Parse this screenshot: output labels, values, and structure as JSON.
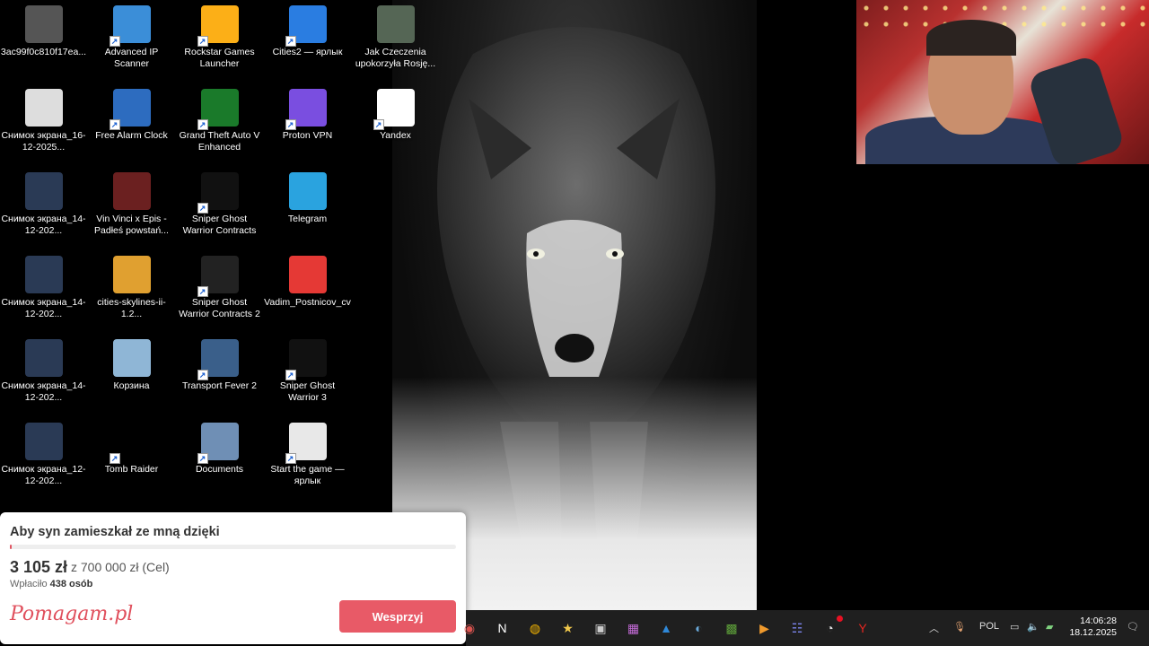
{
  "desktop": {
    "icons": [
      {
        "label": "3ac99f0c810f17ea...",
        "icon": "image-file-icon",
        "col": 0,
        "row": 0,
        "shortcut": false,
        "color": "#555555"
      },
      {
        "label": "Снимок экрана_16-12-2025...",
        "icon": "screenshot-file-icon",
        "col": 0,
        "row": 1,
        "shortcut": false,
        "color": "#dddddd"
      },
      {
        "label": "Снимок экрана_14-12-202...",
        "icon": "screenshot-file-icon",
        "col": 0,
        "row": 2,
        "shortcut": false,
        "color": "#2a3a55"
      },
      {
        "label": "Снимок экрана_14-12-202...",
        "icon": "screenshot-file-icon",
        "col": 0,
        "row": 3,
        "shortcut": false,
        "color": "#2a3a55"
      },
      {
        "label": "Снимок экрана_14-12-202...",
        "icon": "screenshot-file-icon",
        "col": 0,
        "row": 4,
        "shortcut": false,
        "color": "#2a3a55"
      },
      {
        "label": "Снимок экрана_12-12-202...",
        "icon": "screenshot-file-icon",
        "col": 0,
        "row": 5,
        "shortcut": false,
        "color": "#2a3a55"
      },
      {
        "label": "Advanced IP Scanner",
        "icon": "network-scanner-icon",
        "col": 1,
        "row": 0,
        "shortcut": true,
        "color": "#3b8ed8"
      },
      {
        "label": "Free Alarm Clock",
        "icon": "alarm-clock-icon",
        "col": 1,
        "row": 1,
        "shortcut": true,
        "color": "#2d6cbf"
      },
      {
        "label": "Vin Vinci x Epis - Padłeś powstań...",
        "icon": "video-file-icon",
        "col": 1,
        "row": 2,
        "shortcut": false,
        "color": "#6b2020"
      },
      {
        "label": "cities-skylines-ii-1.2...",
        "icon": "rocket-icon",
        "col": 1,
        "row": 3,
        "shortcut": false,
        "color": "#e0a030"
      },
      {
        "label": "Корзина",
        "icon": "recycle-bin-icon",
        "col": 1,
        "row": 4,
        "shortcut": false,
        "color": "#8fb6d6"
      },
      {
        "label": "Tomb Raider",
        "icon": "tomb-raider-icon",
        "col": 1,
        "row": 5,
        "shortcut": true,
        "color": "#000000"
      },
      {
        "label": "Rockstar Games Launcher",
        "icon": "rockstar-icon",
        "col": 2,
        "row": 0,
        "shortcut": true,
        "color": "#fcaf17"
      },
      {
        "label": "Grand Theft Auto V Enhanced",
        "icon": "gta-v-icon",
        "col": 2,
        "row": 1,
        "shortcut": true,
        "color": "#1a7a2a"
      },
      {
        "label": "Sniper Ghost Warrior Contracts",
        "icon": "sgw-contracts-icon",
        "col": 2,
        "row": 2,
        "shortcut": true,
        "color": "#111111"
      },
      {
        "label": "Sniper Ghost Warrior Contracts 2",
        "icon": "sgw-contracts-2-icon",
        "col": 2,
        "row": 3,
        "shortcut": true,
        "color": "#222222"
      },
      {
        "label": "Transport Fever 2",
        "icon": "transport-fever-icon",
        "col": 2,
        "row": 4,
        "shortcut": true,
        "color": "#3a5f8a"
      },
      {
        "label": "Documents",
        "icon": "documents-folder-icon",
        "col": 2,
        "row": 5,
        "shortcut": true,
        "color": "#6f8fb5"
      },
      {
        "label": "Cities2 — ярлык",
        "icon": "cities2-icon",
        "col": 3,
        "row": 0,
        "shortcut": true,
        "color": "#2a7de1"
      },
      {
        "label": "Proton VPN",
        "icon": "proton-vpn-icon",
        "col": 3,
        "row": 1,
        "shortcut": true,
        "color": "#7a4ee0"
      },
      {
        "label": "Telegram",
        "icon": "telegram-icon",
        "col": 3,
        "row": 2,
        "shortcut": false,
        "color": "#2aa3df"
      },
      {
        "label": "Vadim_Postnicov_cv",
        "icon": "pdf-file-icon",
        "col": 3,
        "row": 3,
        "shortcut": false,
        "color": "#e53935"
      },
      {
        "label": "Sniper Ghost Warrior 3",
        "icon": "sgw3-icon",
        "col": 3,
        "row": 4,
        "shortcut": true,
        "color": "#111111"
      },
      {
        "label": "Start the game — ярлык",
        "icon": "settings-gear-icon",
        "col": 3,
        "row": 5,
        "shortcut": true,
        "color": "#e8e8e8"
      },
      {
        "label": "Jak Czeczenia upokorzyła Rosję...",
        "icon": "video-file-icon",
        "col": 4,
        "row": 0,
        "shortcut": false,
        "color": "#556655"
      },
      {
        "label": "Yandex",
        "icon": "yandex-icon",
        "col": 4,
        "row": 1,
        "shortcut": true,
        "color": "#ffffff"
      }
    ]
  },
  "donation": {
    "title": "Aby syn zamieszkał ze mną dzięki",
    "raised": "3 105 zł",
    "goal": "z 700 000 zł (Cel)",
    "supporters_prefix": "Wpłaciło",
    "supporters_count": "438 osób",
    "progress_fraction": 0.0044,
    "logo": "Pomagam.pl",
    "button_label": "Wesprzyj",
    "accent_color": "#e85a67"
  },
  "taskbar": {
    "apps": [
      {
        "name": "red-app-icon",
        "glyph": "◉",
        "color": "#d9534f"
      },
      {
        "name": "notion-icon",
        "glyph": "N",
        "color": "#ffffff"
      },
      {
        "name": "chrome-icon",
        "glyph": "◍",
        "color": "#f4b400"
      },
      {
        "name": "star-app-icon",
        "glyph": "★",
        "color": "#f2c94c"
      },
      {
        "name": "cube-app-icon",
        "glyph": "▣",
        "color": "#cccccc"
      },
      {
        "name": "color-grid-icon",
        "glyph": "▦",
        "color": "#c36bd6"
      },
      {
        "name": "photos-icon",
        "glyph": "▲",
        "color": "#2f88d8"
      },
      {
        "name": "steam-icon",
        "glyph": "◐",
        "color": "#6aa9d9"
      },
      {
        "name": "minecraft-icon",
        "glyph": "▩",
        "color": "#5ea03a"
      },
      {
        "name": "media-player-icon",
        "glyph": "▶",
        "color": "#f09a2d"
      },
      {
        "name": "teams-icon",
        "glyph": "☷",
        "color": "#7b83eb"
      },
      {
        "name": "vpn-app-icon",
        "glyph": "◔",
        "color": "#dddddd"
      },
      {
        "name": "yandex-browser-icon",
        "glyph": "Y",
        "color": "#e52620"
      }
    ],
    "tray": {
      "language": "POL",
      "time": "14:06:28",
      "date": "18.12.2025"
    }
  }
}
